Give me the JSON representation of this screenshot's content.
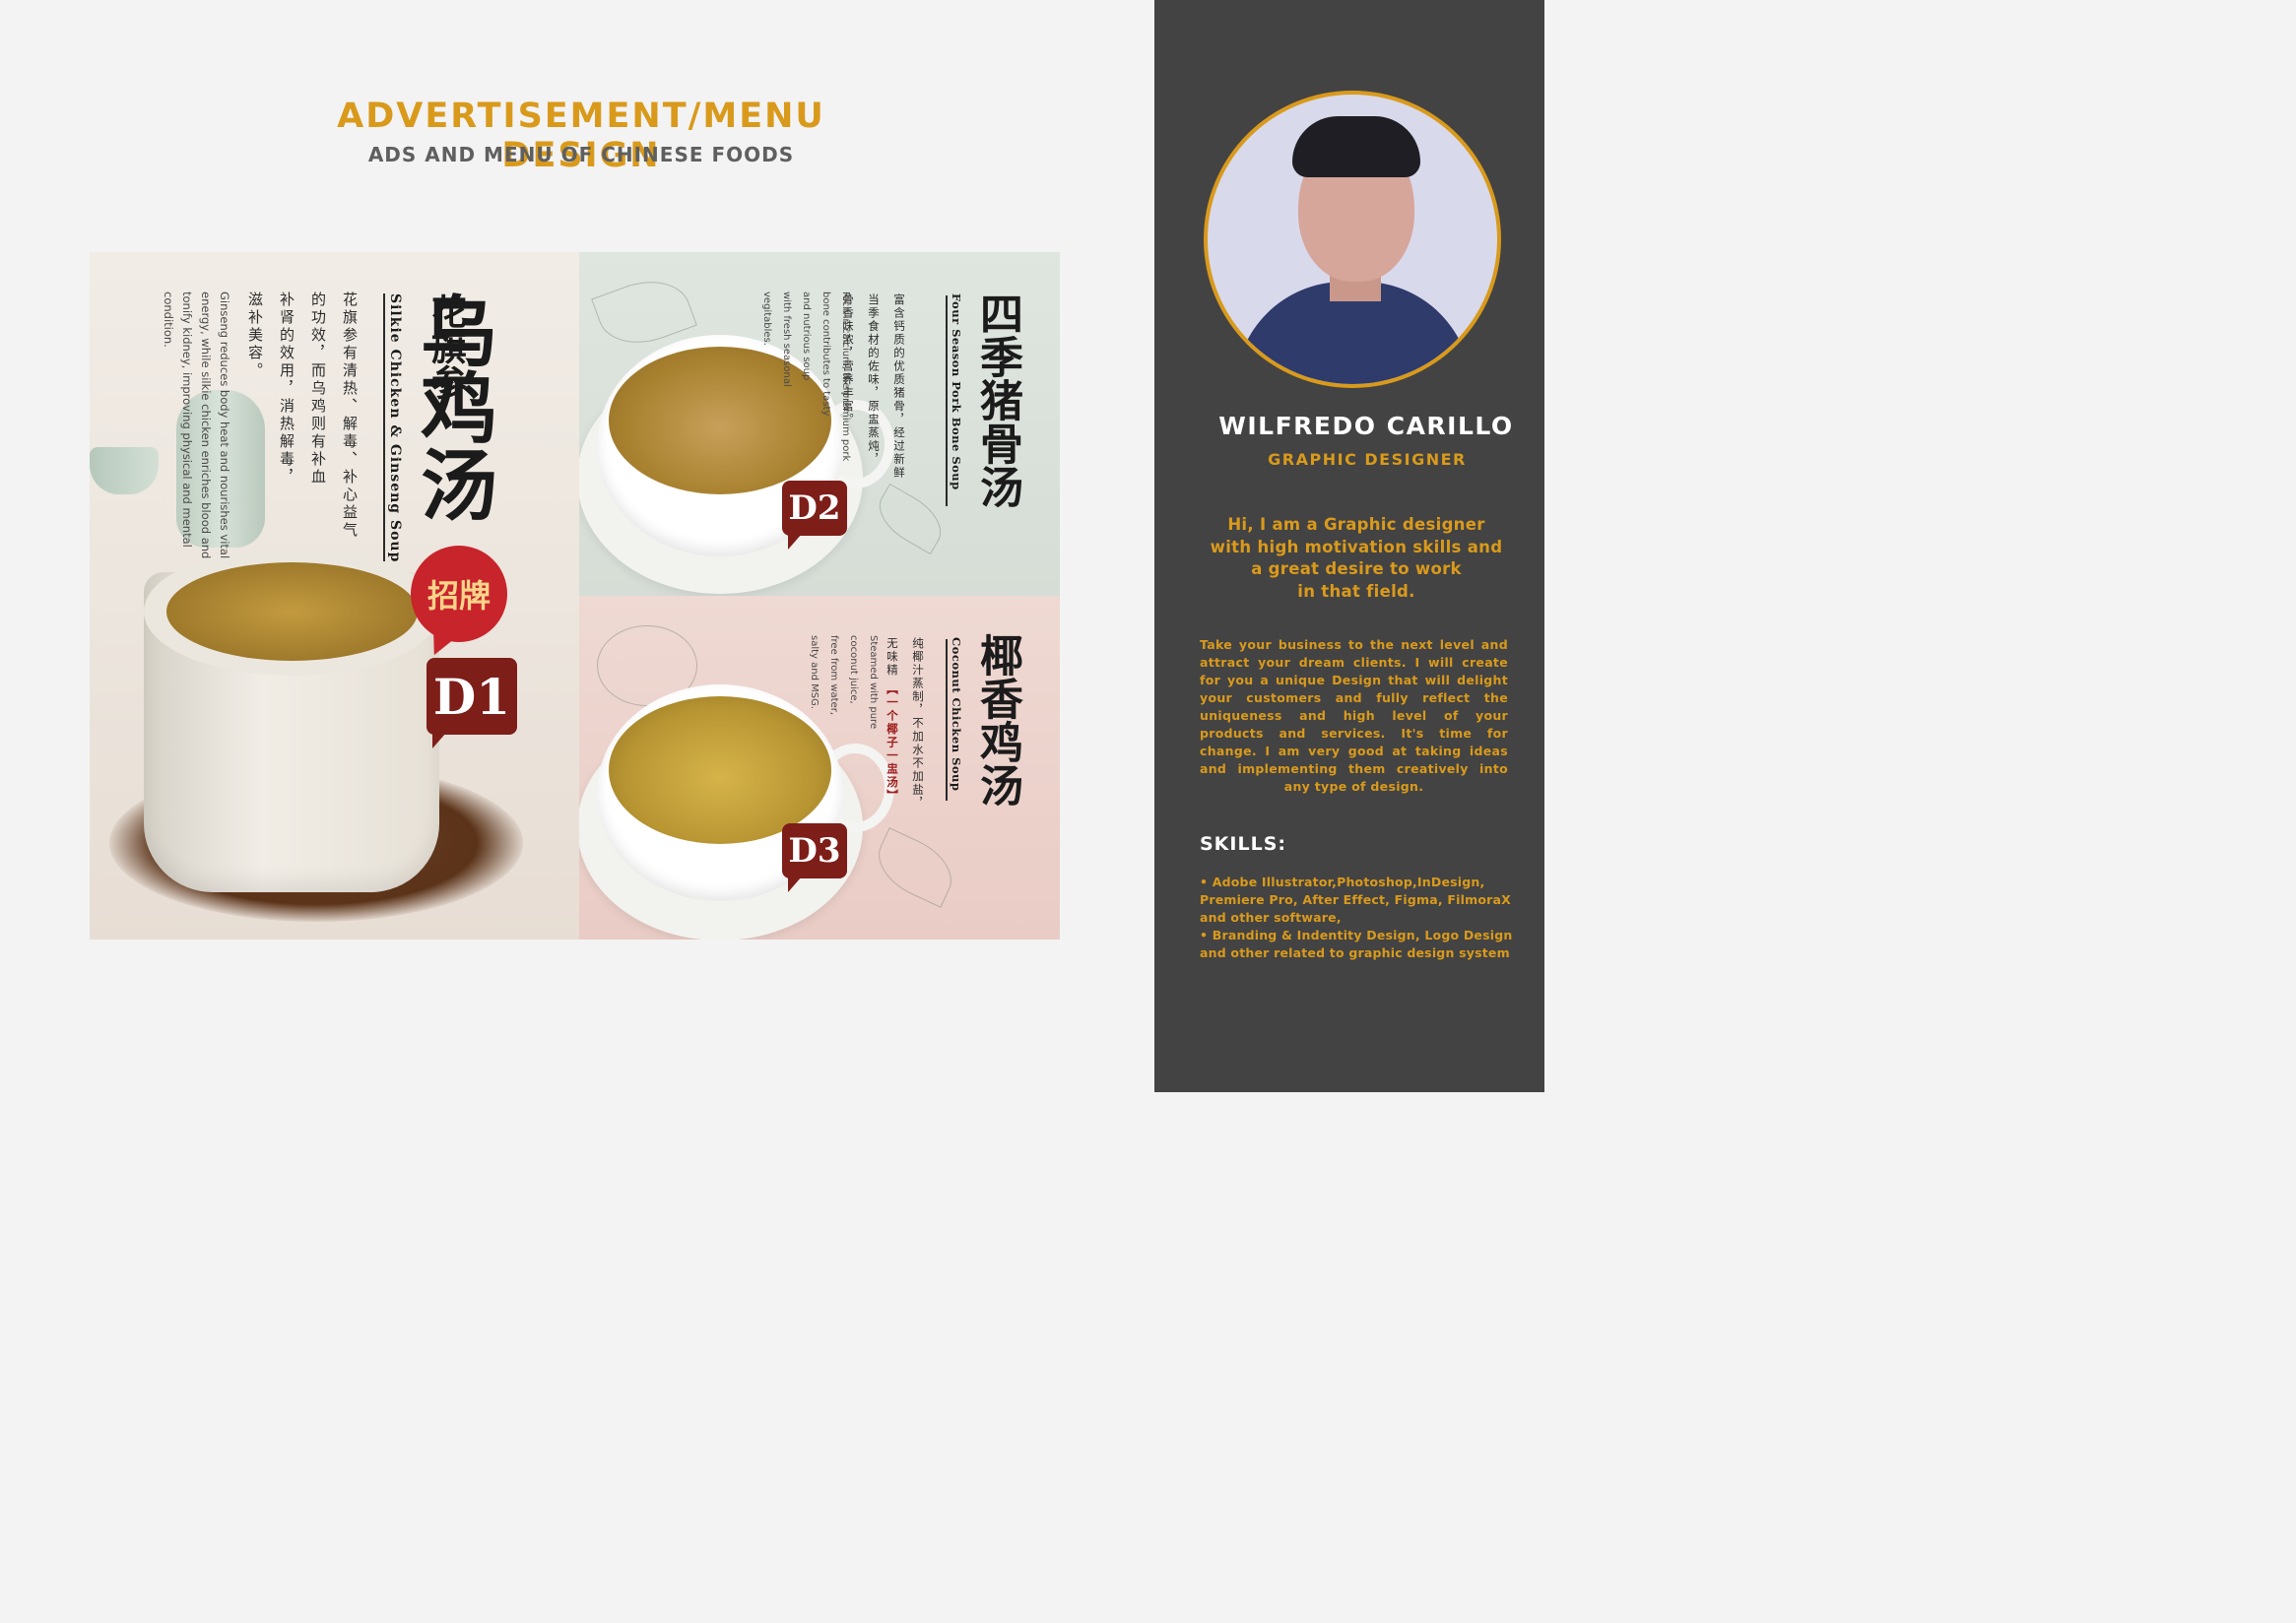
{
  "header": {
    "title": "ADVERTISEMENT/MENU DESIGN",
    "subtitle": "ADS AND MENU OF CHINESE FOODS"
  },
  "menu": {
    "d1": {
      "tag": "D1",
      "badge": "招牌",
      "title_small": "花旗参",
      "title_big": "乌鸡汤",
      "english_title": "Silkie Chicken & Ginseng Soup",
      "cn_lines": [
        "花旗参有清热、解毒、补心益气",
        "的功效，而乌鸡则有补血",
        "补肾的效用，消热解毒，",
        "滋补美容。"
      ],
      "en_lines": [
        "Ginseng reduces body heat and nourishes vital",
        "energy, while silkie chicken enriches blood and",
        "tonify kidney, improving physical and mental",
        "condition."
      ]
    },
    "d2": {
      "tag": "D2",
      "title_big": "四季猪骨汤",
      "english_title": "Four Season Pork Bone Soup",
      "cn_lines": [
        "富含钙质的优质猪骨，经过新鲜",
        "当季食材的佐味，原盅蒸炖，",
        "骨香味浓，营养丰富。"
      ],
      "en_lines": [
        "Rich in calcium, the premium pork",
        "bone contributes to tasty",
        "and nutrious soup",
        "with fresh seasonal",
        "vegitables."
      ]
    },
    "d3": {
      "tag": "D3",
      "title_big": "椰香鸡汤",
      "english_title": "Coconut Chicken Soup",
      "cn_line1": "纯椰汁蒸制，不加水不加盐，",
      "cn_line2_pre": "无味精 ",
      "cn_line2_highlight": "【一个椰子一盅汤】",
      "en_lines": [
        "Steamed with pure",
        "coconut juice,",
        "free from water,",
        "salty and MSG."
      ]
    }
  },
  "profile": {
    "name": "WILFREDO CARILLO",
    "role": "GRAPHIC DESIGNER",
    "intro_lines": [
      "Hi, I am a Graphic designer",
      "with high motivation skills and",
      "a great desire to work",
      "in that field."
    ],
    "pitch": "Take your business to the next level and attract your dream clients. I will create for you a unique Design that will delight your customers and fully reflect the uniqueness and high level of your products and services. It's time for change. I am very good at taking ideas and implementing them creatively into any type of design.",
    "skills_heading": "SKILLS:",
    "skills": [
      "• Adobe Illustrator,Photoshop,InDesign, Premiere Pro, After Effect, Figma, FilmoraX and other software,",
      "• Branding & Indentity Design, Logo Design and other related to graphic design system"
    ]
  },
  "colors": {
    "accent": "#d99a1c",
    "sidebar_bg": "#434343",
    "tag_red": "#7e1e19",
    "badge_red": "#c8242b"
  }
}
